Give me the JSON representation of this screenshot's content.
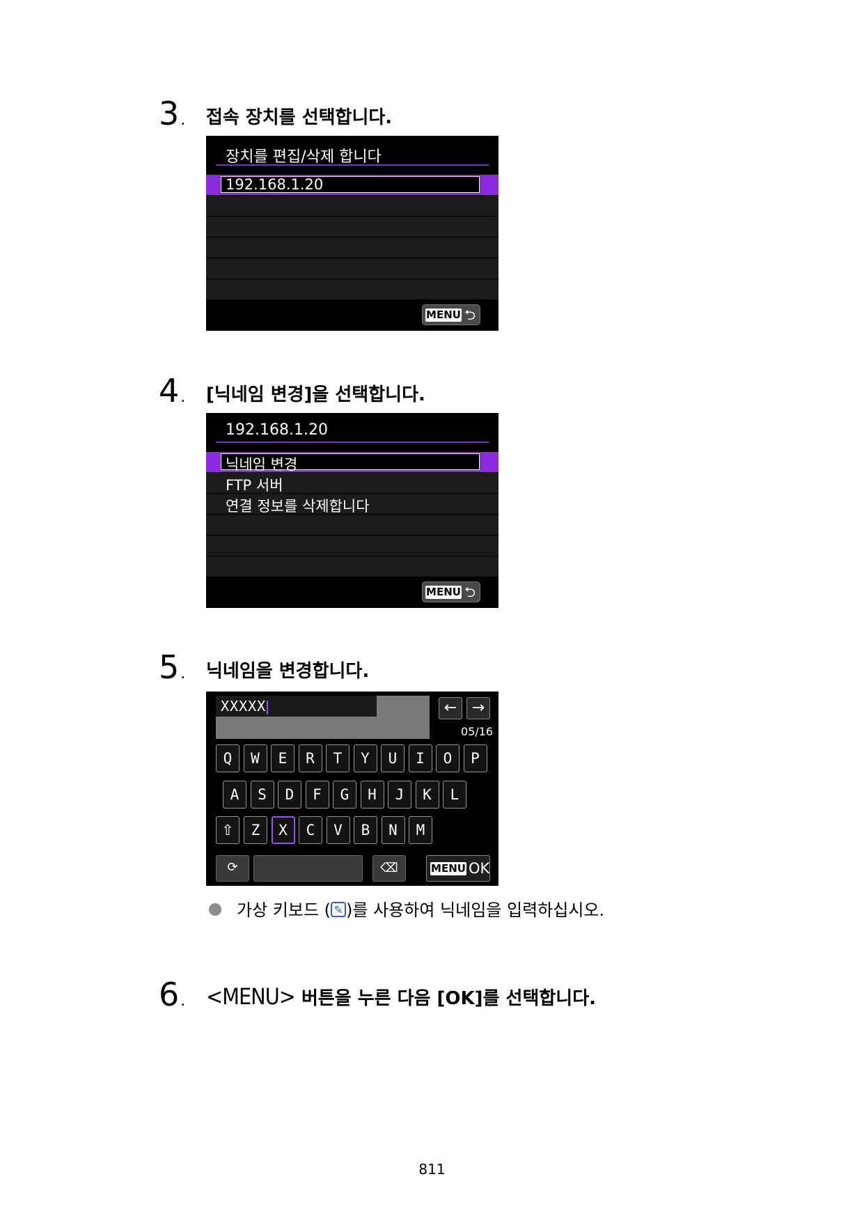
{
  "steps": [
    {
      "number": "3",
      "title": "접속 장치를 선택합니다."
    },
    {
      "number": "4",
      "title": "[닉네임 변경]을 선택합니다."
    },
    {
      "number": "5",
      "title": "닉네임을 변경합니다."
    },
    {
      "number": "6",
      "menu_key": "<MENU>",
      "title": "버튼을 누른 다음 [OK]를 선택합니다."
    }
  ],
  "screen1": {
    "title": "장치를 편집/삭제 합니다",
    "selected_item": "192.168.1.20",
    "menu_label": "MENU",
    "back_icon": "return-icon"
  },
  "screen2": {
    "title": "192.168.1.20",
    "items": [
      "닉네임 변경",
      "FTP 서버",
      "연결 정보를 삭제합니다"
    ],
    "selected_index": 0,
    "menu_label": "MENU",
    "back_icon": "return-icon"
  },
  "keyboard": {
    "input_value": "XXXXX",
    "char_count": "05/16",
    "row1": [
      "Q",
      "W",
      "E",
      "R",
      "T",
      "Y",
      "U",
      "I",
      "O",
      "P"
    ],
    "row2": [
      "A",
      "S",
      "D",
      "F",
      "G",
      "H",
      "J",
      "K",
      "L"
    ],
    "row3": [
      "Z",
      "X",
      "C",
      "V",
      "B",
      "N",
      "M"
    ],
    "selected_key": "X",
    "shift_icon": "shift-arrow-icon",
    "mode_icon": "input-mode-icon",
    "backspace_icon": "backspace-icon",
    "left_arrow_icon": "left-arrow-icon",
    "right_arrow_icon": "right-arrow-icon",
    "menu_label": "MENU",
    "ok_label": "OK"
  },
  "note": {
    "text_before": "가상 키보드 (",
    "text_after": ")를 사용하여 닉네임을 입력하십시오."
  },
  "page_number": "811",
  "colors": {
    "accent_purple": "#8a2be2",
    "icon_blue": "#2b5ed8"
  }
}
